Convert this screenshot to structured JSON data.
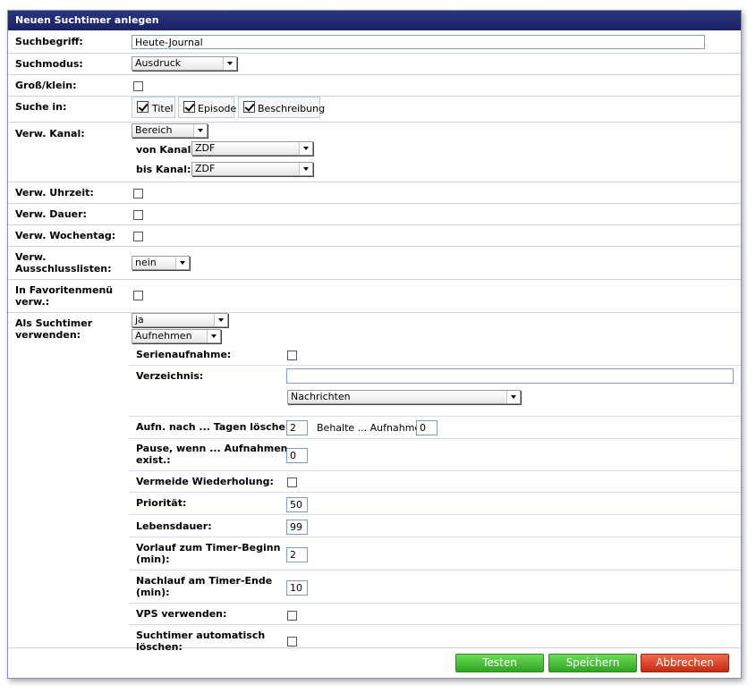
{
  "dialog": {
    "title": "Neuen Suchtimer anlegen"
  },
  "labels": {
    "suchbegriff": "Suchbegriff:",
    "suchmodus": "Suchmodus:",
    "gross_klein": "Groß/klein:",
    "suche_in": "Suche in:",
    "verw_kanal": "Verw. Kanal:",
    "von_kanal": "von Kanal:",
    "bis_kanal": "bis Kanal:",
    "verw_uhrzeit": "Verw. Uhrzeit:",
    "verw_dauer": "Verw. Dauer:",
    "verw_wochentag": "Verw. Wochentag:",
    "verw_ausschluss_1": "Verw.",
    "verw_ausschluss_2": "Ausschlusslisten:",
    "favoriten_1": "In Favoritenmenü",
    "favoriten_2": "verw.:",
    "als_suchtimer_1": "Als Suchtimer",
    "als_suchtimer_2": "verwenden:",
    "serienaufnahme": "Serienaufnahme:",
    "verzeichnis": "Verzeichnis:",
    "aufn_loeschen": "Aufn. nach ... Tagen löschen:",
    "behalte": "Behalte ... Aufnahmen:",
    "pause_1": "Pause, wenn ... Aufnahmen",
    "pause_2": "exist.:",
    "vermeide": "Vermeide Wiederholung:",
    "prioritaet": "Priorität:",
    "lebensdauer": "Lebensdauer:",
    "vorlauf_1": "Vorlauf zum Timer-Beginn",
    "vorlauf_2": "(min):",
    "nachlauf_1": "Nachlauf am Timer-Ende",
    "nachlauf_2": "(min):",
    "vps": "VPS verwenden:",
    "auto_loeschen_1": "Suchtimer automatisch",
    "auto_loeschen_2": "löschen:"
  },
  "values": {
    "suchbegriff": "Heute-Journal",
    "suchmodus": "Ausdruck",
    "suche_in": {
      "titel": "Titel",
      "episode": "Episode",
      "beschreibung": "Beschreibung"
    },
    "verw_kanal": "Bereich",
    "von_kanal": "ZDF",
    "bis_kanal": "ZDF",
    "ausschlusslisten": "nein",
    "als_suchtimer": "ja",
    "aktion": "Aufnehmen",
    "verzeichnis": "",
    "verzeichnis_auswahl": "Nachrichten",
    "tage_loeschen": "2",
    "behalte": "0",
    "pause": "0",
    "prioritaet": "50",
    "lebensdauer": "99",
    "vorlauf": "2",
    "nachlauf": "10"
  },
  "buttons": {
    "testen": "Testen",
    "speichern": "Speichern",
    "abbrechen": "Abbrechen"
  }
}
